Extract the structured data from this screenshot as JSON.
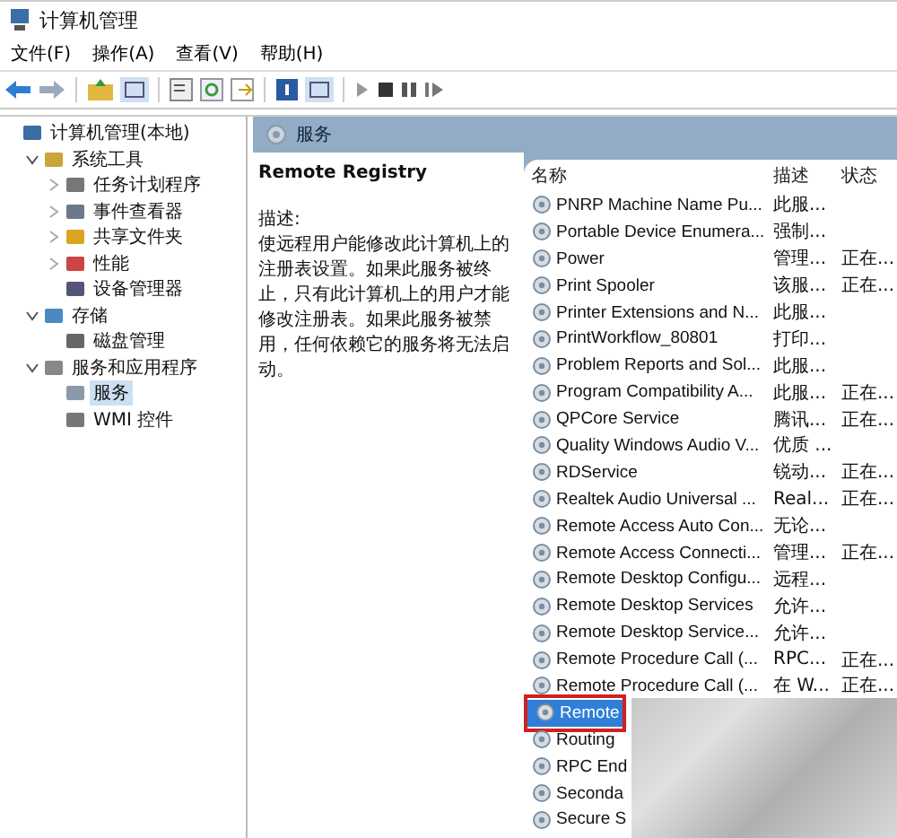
{
  "window": {
    "title": "计算机管理"
  },
  "menu": [
    "文件(F)",
    "操作(A)",
    "查看(V)",
    "帮助(H)"
  ],
  "tree": {
    "label": "计算机管理(本地)",
    "selected": false,
    "children": [
      {
        "label": "系统工具",
        "expanded": true,
        "selected": false,
        "children": [
          {
            "label": "任务计划程序",
            "expanded": false,
            "selected": false
          },
          {
            "label": "事件查看器",
            "expanded": false,
            "selected": false
          },
          {
            "label": "共享文件夹",
            "expanded": false,
            "selected": false
          },
          {
            "label": "性能",
            "expanded": false,
            "selected": false
          },
          {
            "label": "设备管理器",
            "selected": false
          }
        ]
      },
      {
        "label": "存储",
        "expanded": true,
        "selected": false,
        "children": [
          {
            "label": "磁盘管理",
            "selected": false
          }
        ]
      },
      {
        "label": "服务和应用程序",
        "expanded": true,
        "selected": false,
        "children": [
          {
            "label": "服务",
            "selected": true
          },
          {
            "label": "WMI 控件",
            "selected": false
          }
        ]
      }
    ]
  },
  "panel_title": "服务",
  "detail": {
    "name": "Remote Registry",
    "label": "描述:",
    "description": "使远程用户能修改此计算机上的注册表设置。如果此服务被终止，只有此计算机上的用户才能修改注册表。如果此服务被禁用，任何依赖它的服务将无法启动。"
  },
  "columns": [
    "名称",
    "描述",
    "状态"
  ],
  "rows": [
    {
      "name": "PNRP Machine Name Pu...",
      "description": "此服...",
      "selected": false
    },
    {
      "name": "Portable Device Enumera...",
      "description": "强制...",
      "selected": false
    },
    {
      "name": "Power",
      "description": "管理...",
      "status": "正在...",
      "selected": false
    },
    {
      "name": "Print Spooler",
      "description": "该服...",
      "status": "正在...",
      "selected": false
    },
    {
      "name": "Printer Extensions and N...",
      "description": "此服...",
      "selected": false
    },
    {
      "name": "PrintWorkflow_80801",
      "description": "打印...",
      "selected": false
    },
    {
      "name": "Problem Reports and Sol...",
      "description": "此服...",
      "selected": false
    },
    {
      "name": "Program Compatibility A...",
      "description": "此服...",
      "status": "正在...",
      "selected": false
    },
    {
      "name": "QPCore Service",
      "description": "腾讯...",
      "status": "正在...",
      "selected": false
    },
    {
      "name": "Quality Windows Audio V...",
      "description": "优质 ...",
      "selected": false
    },
    {
      "name": "RDService",
      "description": "锐动...",
      "status": "正在...",
      "selected": false
    },
    {
      "name": "Realtek Audio Universal ...",
      "description": "Real...",
      "status": "正在...",
      "selected": false
    },
    {
      "name": "Remote Access Auto Con...",
      "description": "无论...",
      "selected": false
    },
    {
      "name": "Remote Access Connecti...",
      "description": "管理...",
      "status": "正在...",
      "selected": false
    },
    {
      "name": "Remote Desktop Configu...",
      "description": "远程...",
      "selected": false
    },
    {
      "name": "Remote Desktop Services",
      "description": "允许...",
      "selected": false
    },
    {
      "name": "Remote Desktop Service...",
      "description": "允许...",
      "selected": false
    },
    {
      "name": "Remote Procedure Call (...",
      "description": "RPC...",
      "status": "正在...",
      "selected": false
    },
    {
      "name": "Remote Procedure Call (...",
      "description": "在 W...",
      "status": "正在...",
      "selected": false
    },
    {
      "name": "Remote",
      "selected": true,
      "framed": true
    },
    {
      "name": "Routing",
      "selected": false
    },
    {
      "name": "RPC End",
      "selected": false
    },
    {
      "name": "Seconda",
      "selected": false
    },
    {
      "name": "Secure S",
      "selected": false
    }
  ]
}
